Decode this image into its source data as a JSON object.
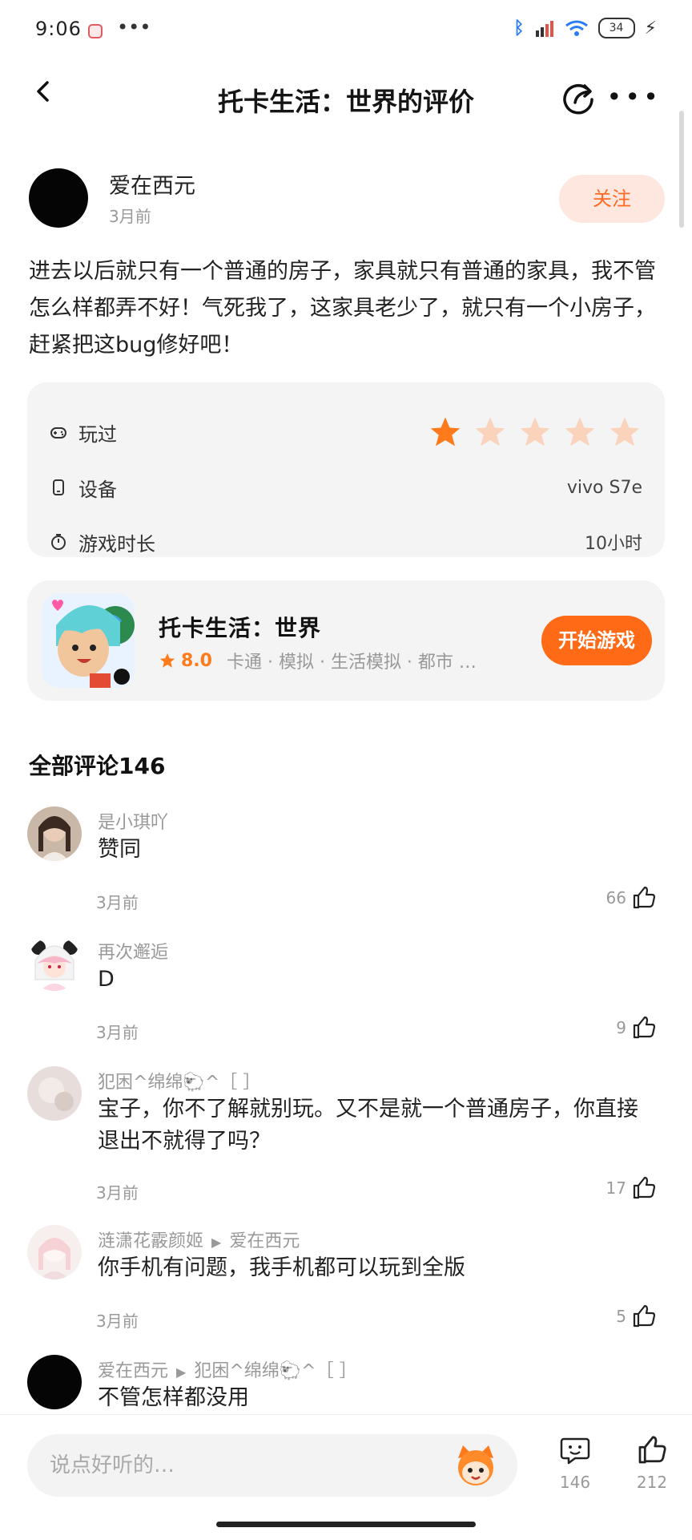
{
  "status_bar": {
    "time": "9:06",
    "battery": "34"
  },
  "header": {
    "title": "托卡生活：世界的评价"
  },
  "review": {
    "author": "爱在西元",
    "time": "3月前",
    "follow_label": "关注",
    "text": "进去以后就只有一个普通的房子，家具就只有普通的家具，我不管怎么样都弄不好！气死我了，这家具老少了，就只有一个小房子，赶紧把这bug修好吧！",
    "rating": 1,
    "rating_max": 5,
    "played_label": "玩过",
    "device_label": "设备",
    "device_value": "vivo S7e",
    "duration_label": "游戏时长",
    "duration_value": "10小时"
  },
  "game": {
    "name": "托卡生活：世界",
    "rating": "8.0",
    "tags": "卡通 · 模拟 · 生活模拟 · 都市 …",
    "start_label": "开始游戏"
  },
  "comments_section": {
    "title": "全部评论146"
  },
  "comments": [
    {
      "name": "是小琪吖",
      "reply_to": "",
      "text": "赞同",
      "time": "3月前",
      "likes": "66",
      "avatar": "photo-girl"
    },
    {
      "name": "再次邂逅",
      "reply_to": "",
      "text": "D",
      "time": "3月前",
      "likes": "9",
      "avatar": "anime-panda"
    },
    {
      "name": "犯困^绵绵🐑^［ ］",
      "reply_to": "",
      "text": "宝子，你不了解就别玩。又不是就一个普通房子，你直接退出不就得了吗？",
      "time": "3月前",
      "likes": "17",
      "avatar": "photo-blur"
    },
    {
      "name": "涟潇花霰颜姬",
      "reply_to": "爱在西元",
      "text": "你手机有问题，我手机都可以玩到全版",
      "time": "3月前",
      "likes": "5",
      "avatar": "photo-pink"
    },
    {
      "name": "爱在西元",
      "reply_to": "犯困^绵绵🐑^［ ］",
      "text": "不管怎样都没用",
      "time": "",
      "likes": "",
      "avatar": "black"
    }
  ],
  "bottom_bar": {
    "placeholder": "说点好听的…",
    "comment_count": "146",
    "like_count": "212"
  },
  "colors": {
    "accent": "#ff6a16",
    "star_active": "#ff7a1a",
    "star_inactive": "#fbd3bc",
    "card_bg": "#f4f4f4"
  }
}
